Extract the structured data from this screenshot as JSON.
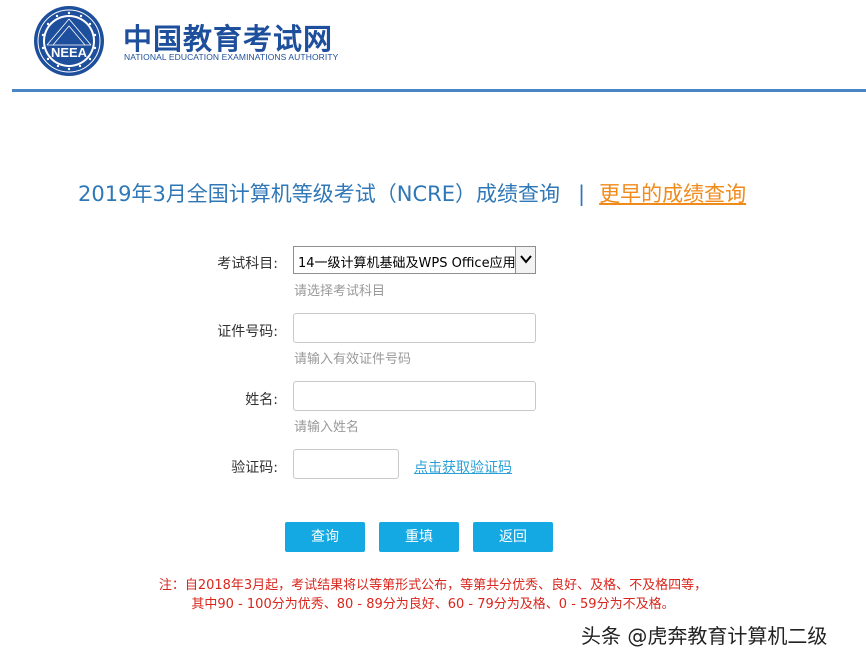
{
  "header": {
    "logo_seal_text": "NEEA",
    "site_name_cn": "中国教育考试网",
    "site_name_en": "NATIONAL EDUCATION EXAMINATIONS AUTHORITY"
  },
  "title": {
    "main": "2019年3月全国计算机等级考试（NCRE）成绩查询",
    "separator": "|",
    "earlier_link": "更早的成绩查询"
  },
  "form": {
    "subject": {
      "label": "考试科目:",
      "selected": "14一级计算机基础及WPS Office应用",
      "hint": "请选择考试科目"
    },
    "id_number": {
      "label": "证件号码:",
      "value": "",
      "hint": "请输入有效证件号码"
    },
    "name": {
      "label": "姓名:",
      "value": "",
      "hint": "请输入姓名"
    },
    "captcha": {
      "label": "验证码:",
      "value": "",
      "link": "点击获取验证码"
    }
  },
  "buttons": {
    "query": "查询",
    "reset": "重填",
    "back": "返回"
  },
  "note": {
    "line1": "注：自2018年3月起，考试结果将以等第形式公布，等第共分优秀、良好、及格、不及格四等，",
    "line2": "其中90 - 100分为优秀、80 - 89分为良好、60 - 79分为及格、0 - 59分为不及格。"
  },
  "watermark": "头条 @虎奔教育计算机二级",
  "colors": {
    "brand_blue": "#1d4f9c",
    "title_blue": "#2f77b6",
    "link_orange": "#f08a1a",
    "button_blue": "#15a9e3",
    "note_red": "#d9261c"
  }
}
